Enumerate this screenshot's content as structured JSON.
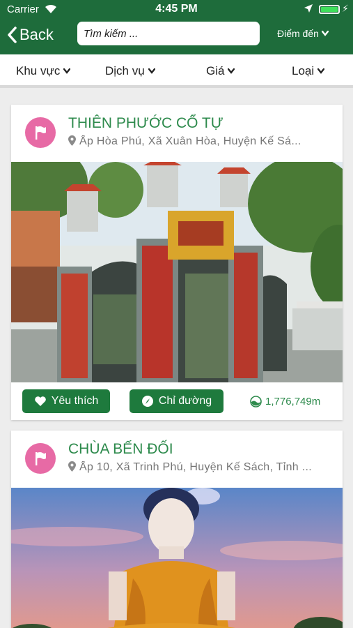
{
  "status_bar": {
    "carrier": "Carrier",
    "time": "4:45 PM"
  },
  "nav": {
    "back_label": "Back",
    "search_placeholder": "Tìm kiếm ...",
    "destination_label": "Điểm đến"
  },
  "filters": [
    "Khu vực",
    "Dịch vụ",
    "Giá",
    "Loại"
  ],
  "places": [
    {
      "name": "THIÊN PHƯỚC CỔ TỰ",
      "address": "Ấp Hòa Phú, Xã Xuân Hòa, Huyện Kế Sá...",
      "favorite_label": "Yêu thích",
      "directions_label": "Chỉ đường",
      "distance": "1,776,749m"
    },
    {
      "name": "CHÙA BẾN ĐỐI",
      "address": "Ấp 10, Xã Trinh Phú, Huyện Kế Sách, Tỉnh ..."
    }
  ],
  "colors": {
    "header": "#1e6c3b",
    "accent": "#2d8a4c",
    "button": "#1e7a3d",
    "flag": "#e76aa5"
  }
}
